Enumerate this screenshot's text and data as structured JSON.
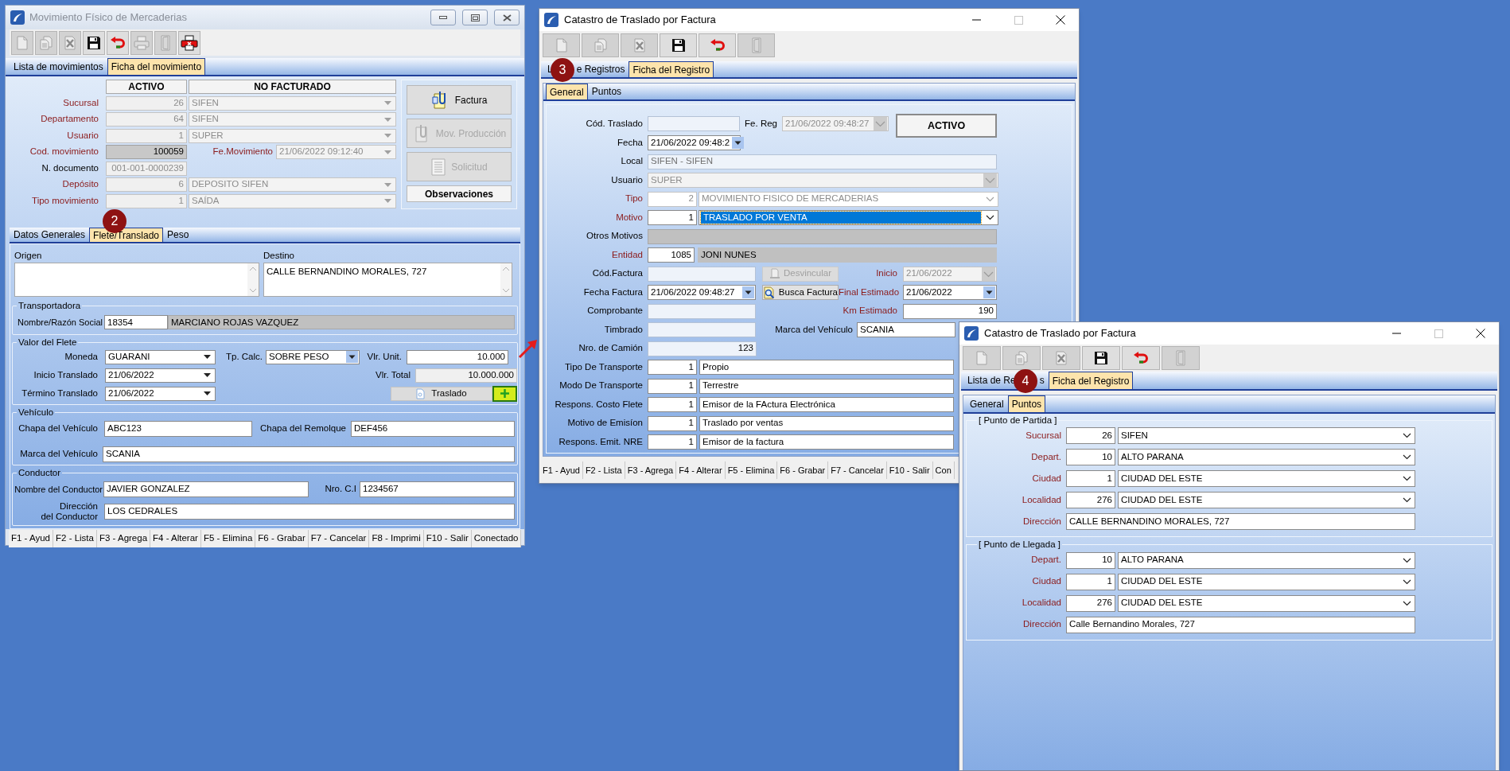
{
  "movimiento_window": {
    "title": "Movimiento Físico de Mercaderias",
    "toolbar": [
      {
        "kind": "new",
        "disabled": true
      },
      {
        "kind": "copy",
        "disabled": true
      },
      {
        "kind": "delete",
        "disabled": true
      },
      {
        "kind": "save",
        "disabled": false
      },
      {
        "kind": "undo",
        "disabled": false
      },
      {
        "kind": "print",
        "disabled": true
      },
      {
        "kind": "exit",
        "disabled": true
      },
      {
        "kind": "print_cancel",
        "disabled": false
      }
    ],
    "tabs": [
      {
        "label": "Lista de movimientos",
        "selected": false
      },
      {
        "label": "Ficha del movimiento",
        "selected": true
      }
    ],
    "status_badges": [
      "ACTIVO",
      "NO FACTURADO"
    ],
    "header_rows": [
      {
        "label": "Sucursal",
        "required": true,
        "code": "26",
        "value": "SIFEN",
        "disabled": true
      },
      {
        "label": "Departamento",
        "required": true,
        "code": "64",
        "value": "SIFEN",
        "disabled": true
      },
      {
        "label": "Usuario",
        "required": true,
        "code": "1",
        "value": "SUPER",
        "disabled": true
      },
      {
        "label": "Cod. movimiento",
        "required": true,
        "code": "100059",
        "disabled": false,
        "date": {
          "label": "Fe.Movimiento",
          "value": "21/06/2022 09:12:40",
          "disabled": true
        }
      },
      {
        "label": "N. documento",
        "required": false,
        "code": "001-001-0000239",
        "disabled": true
      },
      {
        "label": "Depósito",
        "required": true,
        "code": "6",
        "value": "DEPOSITO SIFEN",
        "disabled": true
      },
      {
        "label": "Tipo movimiento",
        "required": true,
        "code": "1",
        "value": "SAÍDA",
        "disabled": true
      }
    ],
    "side_buttons": [
      {
        "label": "Factura",
        "kind": "invoice",
        "disabled": false
      },
      {
        "label": "Mov. Producción",
        "kind": "production",
        "disabled": true
      },
      {
        "label": "Solicitud",
        "kind": "request",
        "disabled": true
      },
      {
        "label": "Observaciones",
        "kind": "plain",
        "disabled": false
      }
    ],
    "sub_tabs": [
      {
        "label": "Datos Generales",
        "selected": false
      },
      {
        "label": "Flete/Translado",
        "selected": true
      },
      {
        "label": "Peso",
        "selected": false
      }
    ],
    "origen": {
      "label": "Origen"
    },
    "destino": {
      "label": "Destino",
      "value": "CALLE BERNANDINO MORALES, 727"
    },
    "transportadora": {
      "legend": "Transportadora",
      "label": "Nombre/Razón Social",
      "code": "18354",
      "name": "MARCIANO ROJAS VAZQUEZ"
    },
    "valor_flete": {
      "legend": "Valor del Flete",
      "moneda": {
        "label": "Moneda",
        "value": "GUARANI"
      },
      "tp_calc": {
        "label": "Tp. Calc.",
        "value": "SOBRE PESO"
      },
      "vlr_unit": {
        "label": "Vlr. Unit.",
        "value": "10.000"
      },
      "inicio": {
        "label": "Inicio Translado",
        "value": "21/06/2022"
      },
      "vlr_total": {
        "label": "Vlr. Total",
        "value": "10.000.000"
      },
      "termino": {
        "label": "Término Translado",
        "value": "21/06/2022"
      },
      "traslado_button": "Traslado",
      "add_highlighted": true
    },
    "vehiculo": {
      "legend": "Vehículo",
      "chapa": {
        "label": "Chapa del Vehículo",
        "value": "ABC123"
      },
      "remolque": {
        "label": "Chapa del Remolque",
        "value": "DEF456"
      },
      "marca": {
        "label": "Marca del Vehículo",
        "value": "SCANIA"
      }
    },
    "conductor": {
      "legend": "Conductor",
      "nombre": {
        "label": "Nombre del Conductor",
        "value": "JAVIER GONZALEZ"
      },
      "ci": {
        "label": "Nro. C.I",
        "value": "1234567"
      },
      "direccion": {
        "label": "Dirección\ndel Conductor",
        "value": "LOS CEDRALES"
      }
    },
    "status_bar": [
      "F1 - Ayud",
      "F2 - Lista",
      "F3 - Agrega",
      "F4 - Alterar",
      "F5 - Elimina",
      "F6 - Grabar",
      "F7 - Cancelar",
      "F8 - Imprimi",
      "F10 - Salir",
      "Conectado"
    ]
  },
  "traslado_window": {
    "title": "Catastro de Traslado por Factura",
    "toolbar": [
      {
        "kind": "new",
        "disabled": true
      },
      {
        "kind": "copy",
        "disabled": true
      },
      {
        "kind": "delete",
        "disabled": true
      },
      {
        "kind": "save",
        "disabled": false
      },
      {
        "kind": "undo",
        "disabled": false
      },
      {
        "kind": "exit",
        "disabled": true
      }
    ],
    "tabs": [
      {
        "label_parts": [
          "L",
          "e Registros"
        ],
        "selected": false
      },
      {
        "label": "Ficha del Registro",
        "selected": true
      }
    ],
    "sub_tabs": [
      {
        "label": "General",
        "selected": true
      },
      {
        "label": "Puntos",
        "selected": false
      }
    ],
    "cod_traslado": {
      "label": "Cód. Traslado"
    },
    "fe_reg": {
      "label": "Fe. Reg",
      "value": "21/06/2022 09:48:27",
      "disabled": true
    },
    "estado": "ACTIVO",
    "fecha": {
      "label": "Fecha",
      "value": "21/06/2022 09:48:2"
    },
    "local": {
      "label": "Local",
      "value": "SIFEN - SIFEN"
    },
    "usuario": {
      "label": "Usuario",
      "value": "SUPER",
      "disabled": true
    },
    "tipo": {
      "label": "Tipo",
      "required": true,
      "code": "2",
      "value": "MOVIMIENTO FISICO DE MERCADERIAS",
      "disabled": true
    },
    "motivo": {
      "label": "Motivo",
      "required": true,
      "code": "1",
      "value": "TRASLADO POR VENTA",
      "disabled": false,
      "selected": true
    },
    "otros_motivos": {
      "label": "Otros Motivos"
    },
    "entidad": {
      "label": "Entidad",
      "required": true,
      "code": "1085",
      "value": "JONI NUNES"
    },
    "cod_factura": {
      "label": "Cód.Factura"
    },
    "desvincular": {
      "label": "Desvincular",
      "disabled": true
    },
    "inicio": {
      "label": "Inicio",
      "required": true,
      "value": "21/06/2022",
      "disabled": true
    },
    "fecha_factura": {
      "label": "Fecha Factura",
      "value": "21/06/2022 09:48:27"
    },
    "busca_factura": {
      "label": "Busca Factura",
      "disabled": false
    },
    "final_estimado": {
      "label": "Final Estimado",
      "required": true,
      "value": "21/06/2022",
      "disabled": false
    },
    "comprobante": {
      "label": "Comprobante"
    },
    "km_estimado": {
      "label": "Km Estimado",
      "required": true,
      "value": "190"
    },
    "timbrado": {
      "label": "Timbrado"
    },
    "marca": {
      "label": "Marca del Vehículo",
      "value": "SCANIA"
    },
    "nro_camion": {
      "label": "Nro. de Camión",
      "value": "123"
    },
    "transport_rows": [
      {
        "label": "Tipo De Transporte",
        "code": "1",
        "value": "Propio"
      },
      {
        "label": "Modo De Transporte",
        "code": "1",
        "value": "Terrestre"
      },
      {
        "label": "Respons. Costo Flete",
        "code": "1",
        "value": "Emisor de la FActura Electrónica"
      },
      {
        "label": "Motivo de Emisíon",
        "code": "1",
        "value": "Traslado por ventas"
      },
      {
        "label": "Respons. Emit. NRE",
        "code": "1",
        "value": "Emisor de la factura"
      }
    ],
    "status_bar": [
      "F1 - Ayud",
      "F2 - Lista",
      "F3 - Agrega",
      "F4 - Alterar",
      "F5 - Elimina",
      "F6 - Grabar",
      "F7 - Cancelar",
      "F10 - Salir",
      "Con"
    ]
  },
  "puntos_window": {
    "title": "Catastro de Traslado por Factura",
    "toolbar": [
      {
        "kind": "new",
        "disabled": true
      },
      {
        "kind": "copy",
        "disabled": true
      },
      {
        "kind": "delete",
        "disabled": true
      },
      {
        "kind": "save",
        "disabled": false
      },
      {
        "kind": "undo",
        "disabled": false
      },
      {
        "kind": "exit",
        "disabled": true
      }
    ],
    "tabs": [
      {
        "label_parts": [
          "Lista de Re",
          "s"
        ],
        "selected": false
      },
      {
        "label": "Ficha del Registro",
        "selected": true
      }
    ],
    "sub_tabs": [
      {
        "label": "General",
        "selected": false
      },
      {
        "label": "Puntos",
        "selected": true
      }
    ],
    "groups": [
      {
        "legend": "[ Punto de Partida ]",
        "rows": [
          {
            "label": "Sucursal",
            "required": true,
            "kind": "combo",
            "code": "26",
            "value": "SIFEN"
          },
          {
            "label": "Depart.",
            "required": true,
            "kind": "combo",
            "code": "10",
            "value": "ALTO PARANA"
          },
          {
            "label": "Ciudad",
            "required": true,
            "kind": "combo",
            "code": "1",
            "value": "CIUDAD DEL ESTE"
          },
          {
            "label": "Localidad",
            "required": true,
            "kind": "combo",
            "code": "276",
            "value": "CIUDAD DEL ESTE"
          },
          {
            "label": "Dirección",
            "required": true,
            "kind": "text",
            "value": "CALLE BERNANDINO MORALES, 727"
          }
        ]
      },
      {
        "legend": "[ Punto de Llegada ]",
        "rows": [
          {
            "label": "Depart.",
            "required": true,
            "kind": "combo",
            "code": "10",
            "value": "ALTO PARANA"
          },
          {
            "label": "Ciudad",
            "required": true,
            "kind": "combo",
            "code": "1",
            "value": "CIUDAD DEL ESTE"
          },
          {
            "label": "Localidad",
            "required": true,
            "kind": "combo",
            "code": "276",
            "value": "CIUDAD DEL ESTE"
          },
          {
            "label": "Dirección",
            "required": true,
            "kind": "text",
            "value": "Calle Bernandino Morales, 727"
          }
        ]
      }
    ]
  },
  "annotations": [
    "2",
    "3",
    "4"
  ]
}
